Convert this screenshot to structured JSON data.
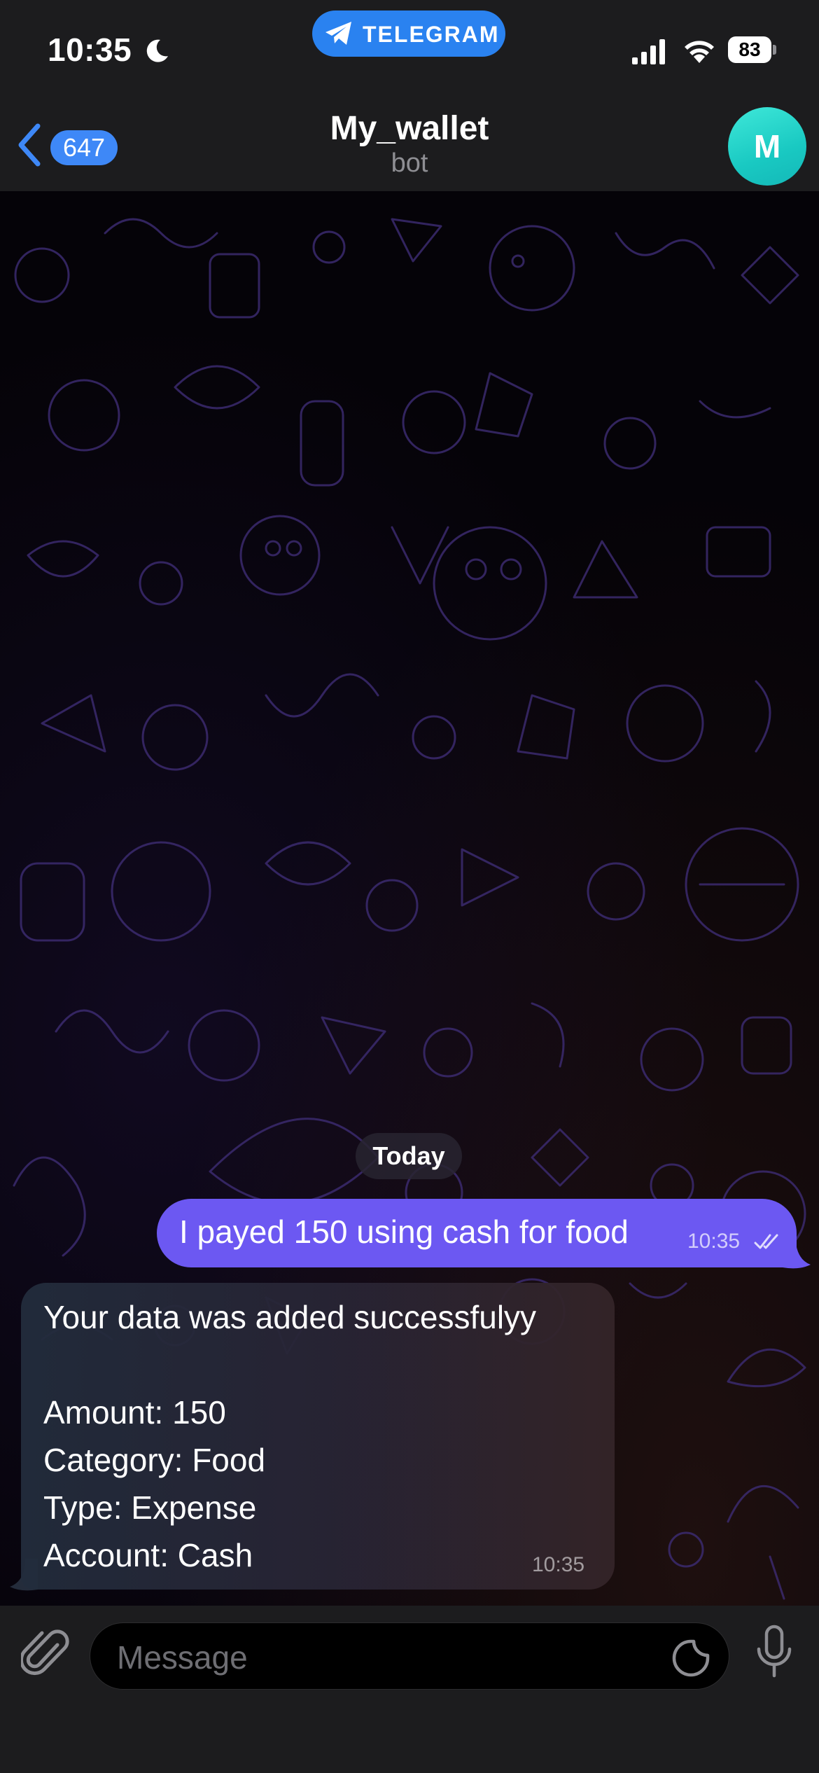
{
  "status_bar": {
    "time": "10:35",
    "app_pill": "TELEGRAM",
    "battery": "83",
    "icons": [
      "moon-icon",
      "telegram-plane-icon",
      "signal-icon",
      "wifi-icon",
      "battery-icon"
    ]
  },
  "header": {
    "back_badge": "647",
    "title": "My_wallet",
    "subtitle": "bot",
    "avatar_initial": "M",
    "accent": "#3e88f7",
    "avatar_color": "#2cd6cf"
  },
  "chat": {
    "date_label": "Today",
    "messages": [
      {
        "direction": "outgoing",
        "text": "I payed 150 using cash for food",
        "time": "10:35",
        "status": "read",
        "color": "#6c58f2"
      },
      {
        "direction": "incoming",
        "lines": [
          "Your data was added successfulyy",
          "",
          "Amount: 150",
          "Category: Food",
          "Type: Expense",
          "Account: Cash"
        ],
        "time": "10:35"
      }
    ]
  },
  "input": {
    "placeholder": "Message",
    "icons": [
      "paperclip-icon",
      "sticker-icon",
      "microphone-icon"
    ]
  }
}
